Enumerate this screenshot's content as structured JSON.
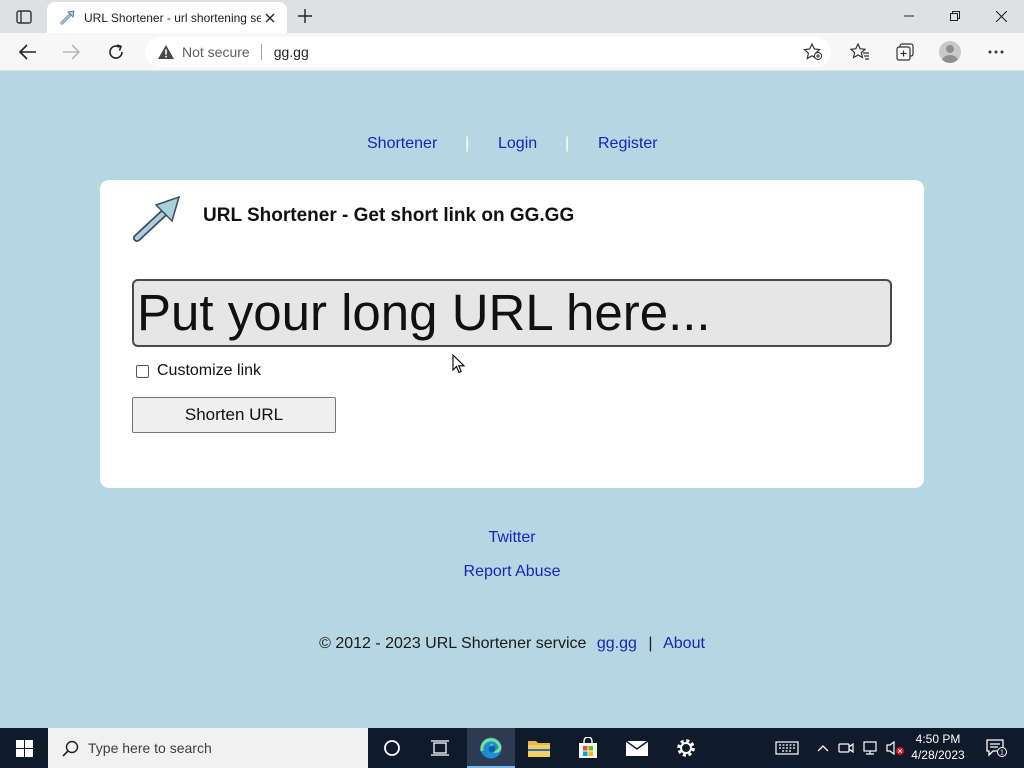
{
  "browser": {
    "tab_title": "URL Shortener - url shortening service",
    "new_tab_symbol": "+",
    "address": {
      "security_label": "Not secure",
      "url": "gg.gg"
    }
  },
  "page": {
    "nav": [
      {
        "label": "Shortener"
      },
      {
        "label": "Login"
      },
      {
        "label": "Register"
      }
    ],
    "nav_separator": "|",
    "card": {
      "title": "URL Shortener - Get short link on GG.GG",
      "input_placeholder": "Put your long URL here...",
      "checkbox_label": "Customize link",
      "checkbox_checked": false,
      "button_label": "Shorten URL"
    },
    "footer": {
      "twitter": "Twitter",
      "report_abuse": "Report Abuse",
      "copyright": "© 2012 - 2023 URL Shortener service",
      "site_link": "gg.gg",
      "separator": "|",
      "about": "About"
    }
  },
  "taskbar": {
    "search_placeholder": "Type here to search",
    "time": "4:50 PM",
    "date": "4/28/2023",
    "notification_count": "1",
    "accent_color": "#76b9ed"
  },
  "colors": {
    "page_background": "#b5d6e3",
    "link": "#1b23b6",
    "card": "#ffffff"
  }
}
